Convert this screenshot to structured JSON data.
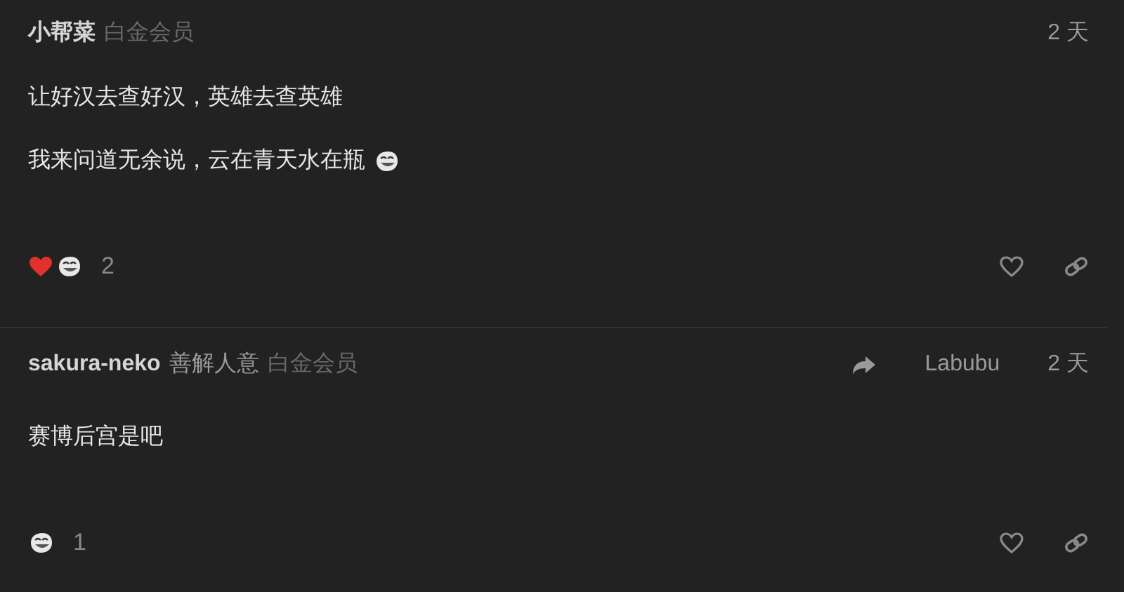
{
  "posts": [
    {
      "author": "小帮菜",
      "badge": "白金会员",
      "time": "2 天",
      "paragraphs": [
        {
          "text": "让好汉去查好汉，英雄去查英雄"
        },
        {
          "text": "我来问道无余说，云在青天水在瓶",
          "trailing_emoji": {
            "kind": "troll"
          }
        }
      ],
      "reactions": [
        {
          "kind": "heart"
        },
        {
          "kind": "troll"
        }
      ],
      "reaction_count": "2"
    },
    {
      "author": "sakura-neko",
      "user_title": "善解人意",
      "badge": "白金会员",
      "reply_to": {
        "name": "Labubu"
      },
      "time": "2 天",
      "paragraphs": [
        {
          "text": "赛博后宫是吧"
        }
      ],
      "reactions": [
        {
          "kind": "troll"
        }
      ],
      "reaction_count": "1"
    }
  ]
}
